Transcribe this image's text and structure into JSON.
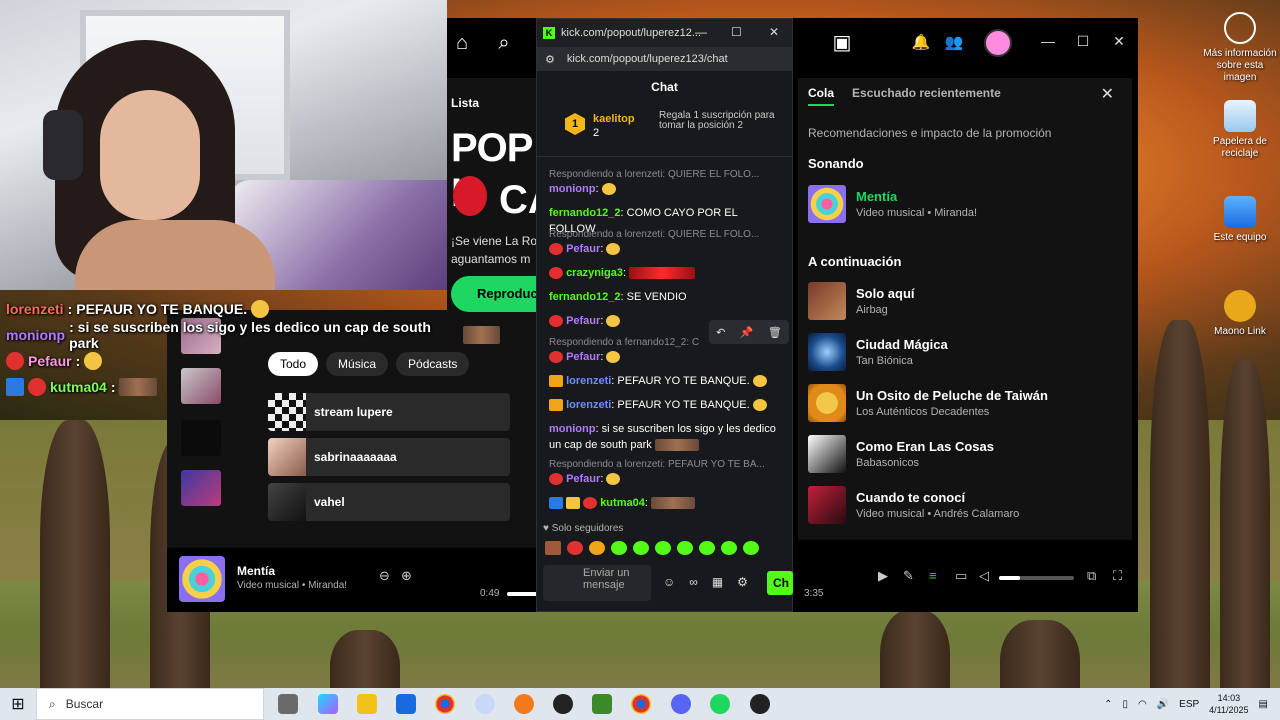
{
  "stream_chat": [
    {
      "user": "lorenzeti",
      "text": "PEFAUR YO TE BANQUE."
    },
    {
      "user": "monionp",
      "text": ": si se suscriben los sigo y les dedico un cap de south park"
    },
    {
      "user": "Pefaur",
      "text": ":"
    },
    {
      "user": "kutma04",
      "text": ":"
    }
  ],
  "spotify": {
    "lista_label": "Lista",
    "playlist_title_1": "POP I",
    "playlist_title_2": "CA",
    "blurb_1": "¡Se viene La Ro",
    "blurb_2": "aguantamos m",
    "play_label": "Reproduc",
    "chips": [
      "Todo",
      "Música",
      "Pódcasts"
    ],
    "shortcuts": [
      "stream lupere",
      "sabrinaaaaaaa",
      "vahel"
    ]
  },
  "queue": {
    "tabs": [
      "Cola",
      "Escuchado recientemente"
    ],
    "reco": "Recomendaciones e impacto de la promoción",
    "now_heading": "Sonando",
    "now_title": "Mentía",
    "now_sub": "Video musical • Miranda!",
    "next_heading": "A continuación",
    "items": [
      {
        "title": "Solo aquí",
        "sub": "Airbag"
      },
      {
        "title": "Ciudad Mágica",
        "sub": "Tan Biónica"
      },
      {
        "title": "Un Osito de Peluche de Taiwán",
        "sub": "Los Auténticos Decadentes"
      },
      {
        "title": "Como Eran Las Cosas",
        "sub": "Babasonicos"
      },
      {
        "title": "Cuando te conocí",
        "sub": "Video musical • Andrés Calamaro"
      }
    ]
  },
  "player": {
    "title": "Mentía",
    "sub": "Video musical • Miranda!",
    "elapsed": "0:49",
    "duration": "3:35",
    "volume_level": 0.28
  },
  "kick": {
    "window_title": "kick.com/popout/luperez12...",
    "url": "kick.com/popout/luperez123/chat",
    "header": "Chat",
    "gift_user": "kaelitop",
    "gift_rank": "1",
    "gift_count": "2",
    "gift_text": "Regala 1 suscripción para tomar la posición 2",
    "messages": [
      {
        "kind": "reply",
        "text": "Respondiendo a lorenzeti: QUIERE EL FOLO..."
      },
      {
        "kind": "msg",
        "user": "monionp",
        "text": ""
      },
      {
        "kind": "msg",
        "user": "fernando12_2",
        "text": "COMO CAYO POR EL FOLLOW"
      },
      {
        "kind": "reply",
        "text": "Respondiendo a lorenzeti: QUIERE EL FOLO..."
      },
      {
        "kind": "msg",
        "user": "Pefaur",
        "text": ""
      },
      {
        "kind": "msg",
        "user": "crazyniga3",
        "text": ""
      },
      {
        "kind": "msg",
        "user": "fernando12_2",
        "text": "SE VENDIO"
      },
      {
        "kind": "msg",
        "user": "Pefaur",
        "text": ""
      },
      {
        "kind": "reply",
        "text": "Respondiendo a fernando12_2: C"
      },
      {
        "kind": "msg",
        "user": "Pefaur",
        "text": ""
      },
      {
        "kind": "msg",
        "user": "lorenzeti",
        "text": "PEFAUR YO TE BANQUE."
      },
      {
        "kind": "msg",
        "user": "lorenzeti",
        "text": "PEFAUR YO TE BANQUE."
      },
      {
        "kind": "msg",
        "user": "monionp",
        "text": "si se suscriben los sigo y les dedico un cap de south park"
      },
      {
        "kind": "reply",
        "text": "Respondiendo a lorenzeti: PEFAUR YO TE BA..."
      },
      {
        "kind": "msg",
        "user": "Pefaur",
        "text": ""
      },
      {
        "kind": "msg",
        "user": "kutma04",
        "text": ""
      }
    ],
    "followers_label": "Solo seguidores",
    "input_placeholder": "Enviar un mensaje",
    "send_label": "Ch"
  },
  "desktop_icons": [
    "Más información sobre esta imagen",
    "Papelera de reciclaje",
    "Este equipo",
    "Maono Link"
  ],
  "taskbar": {
    "search": "Buscar",
    "lang": "ESP",
    "time": "14:03",
    "date": "4/11/2025"
  }
}
